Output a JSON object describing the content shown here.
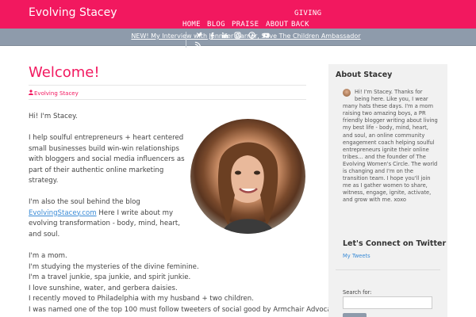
{
  "header": {
    "site_title": "Evolving Stacey",
    "nav": [
      {
        "label": "GIVING"
      },
      {
        "label": "HOME"
      },
      {
        "label": "BLOG"
      },
      {
        "label": "PRAISE"
      },
      {
        "label": "ABOUT"
      },
      {
        "label": "BACK"
      }
    ],
    "brand_color": "#f2185f",
    "bar_color": "#8e9bab"
  },
  "announcement": {
    "text": "NEW! My Interview with Jennifer Garner, Save The Children Ambassador",
    "social_icons": [
      "twitter-icon",
      "facebook-icon",
      "linkedin-icon",
      "instagram-icon",
      "pinterest-icon",
      "youtube-icon",
      "rss-icon"
    ]
  },
  "post": {
    "title": "Welcome!",
    "author": "Evolving Stacey",
    "paragraphs": {
      "p1": "Hi! I'm Stacey.",
      "p2_l1": "I help soulful entrepreneurs + heart centered",
      "p2_l2": "small businesses build win-win relationships",
      "p2_l3": "with bloggers and social media influencers as",
      "p2_l4": "part of their authentic online marketing",
      "p2_l5": "strategy.",
      "p3_l1": "I'm also the soul behind the blog",
      "p3_link": "EvolvingStacey.com",
      "p3_l2_rest": " Here I write about my",
      "p3_l3": "evolving transformation - body, mind, heart,",
      "p3_l4": "and soul.",
      "p4_l1": "I'm a mom.",
      "p4_l2": "I'm studying the mysteries of the divine feminine.",
      "p4_l3": "I'm a travel junkie, spa junkie, and spirit junkie.",
      "p4_l4": "I love sunshine, water, and gerbera daisies.",
      "p4_l5": "I recently moved to Philadelphia with my husband + two children.",
      "p4_l6": "I was named one of the top 100 must follow tweeters of social good by Armchair Advocates."
    },
    "portrait_icon": "portrait-photo"
  },
  "sidebar": {
    "about_title": "About Stacey",
    "about_lines": [
      "Hi! I'm Stacey. Thanks for",
      "being here. Like you, I wear",
      "many hats these days. I'm a mom",
      "raising two amazing boys, a PR",
      "friendly blogger writing about living",
      "my best life - body, mind, heart,",
      "and soul, an online community",
      "engagement coach helping soulful",
      "entrepreneurs ignite their online",
      "tribes… and the founder of The",
      "Evolving Women's Circle. The world",
      "is changing and I'm on the",
      "transition team. I hope you'll join",
      "me as I gather women to share,",
      "witness, engage, ignite, activate,",
      "and grow with me. xoxo"
    ],
    "twitter_title": "Let's Connect on Twitter",
    "twitter_link": "My Tweets",
    "search_label": "Search for:",
    "search_value": ""
  }
}
